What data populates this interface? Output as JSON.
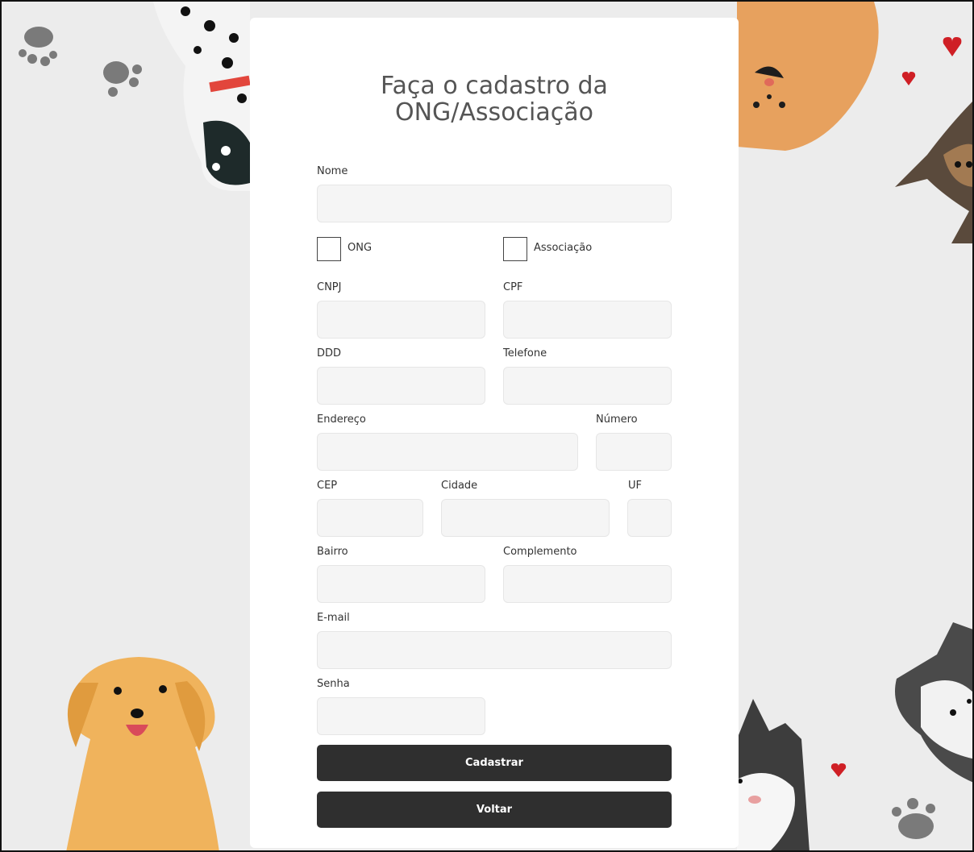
{
  "form": {
    "title_line1": "Faça o cadastro da",
    "title_line2": "ONG/Associação",
    "labels": {
      "nome": "Nome",
      "ong": "ONG",
      "associacao": "Associação",
      "cnpj": "CNPJ",
      "cpf": "CPF",
      "ddd": "DDD",
      "telefone": "Telefone",
      "endereco": "Endereço",
      "numero": "Número",
      "cep": "CEP",
      "cidade": "Cidade",
      "uf": "UF",
      "bairro": "Bairro",
      "complemento": "Complemento",
      "email": "E-mail",
      "senha": "Senha"
    },
    "values": {
      "nome": "",
      "cnpj": "",
      "cpf": "",
      "ddd": "",
      "telefone": "",
      "endereco": "",
      "numero": "",
      "cep": "",
      "cidade": "",
      "uf": "",
      "bairro": "",
      "complemento": "",
      "email": "",
      "senha": ""
    },
    "checkboxes": {
      "ong": false,
      "associacao": false
    },
    "buttons": {
      "submit": "Cadastrar",
      "back": "Voltar"
    }
  },
  "colors": {
    "button_bg": "#2f2f2f",
    "field_bg": "#f5f5f5",
    "title": "#555555",
    "page_bg": "#ececec"
  },
  "background": {
    "decorations": [
      "dalmatian-illustration",
      "paw-print-icon",
      "orange-dog-illustration",
      "german-shepherd-illustration",
      "golden-retriever-illustration",
      "cat-illustration",
      "husky-illustration",
      "heart-icon"
    ]
  }
}
